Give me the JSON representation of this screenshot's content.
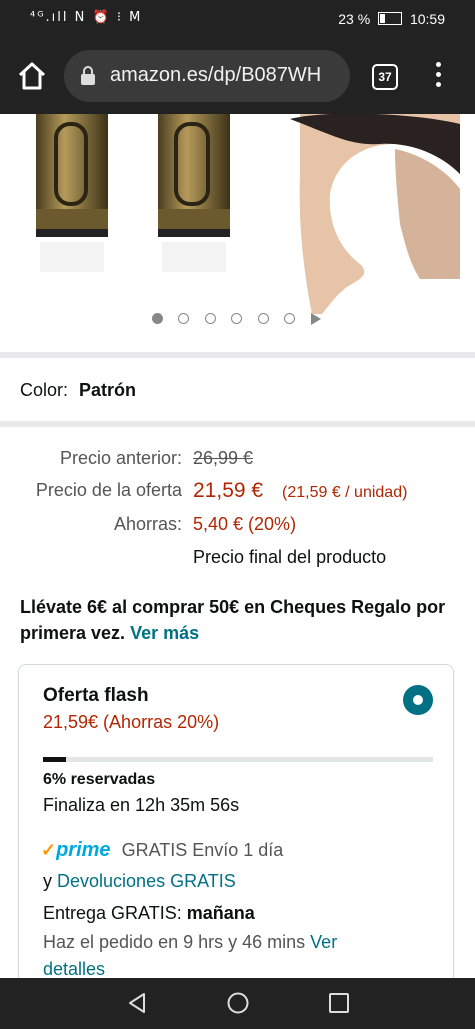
{
  "status_bar": {
    "left": "⁴ᴳ.ıll N ⏰ ⁝ M",
    "battery": "23 %",
    "time": "10:59"
  },
  "browser": {
    "url": "amazon.es/dp/B087WH",
    "tab_count": "37"
  },
  "gallery": {
    "dot_count": 6,
    "active_index": 0
  },
  "product": {
    "color_label": "Color:",
    "color_value": "Patrón"
  },
  "pricing": {
    "previous_label": "Precio anterior:",
    "previous_price": "26,99 €",
    "offer_label": "Precio de la oferta",
    "offer_price": "21,59 €",
    "unit_price": "(21,59 € / unidad)",
    "savings_label": "Ahorras:",
    "savings_value": "5,40 € (20%)",
    "final_note": "Precio final del producto"
  },
  "promo": {
    "text": "Llévate 6€ al comprar 50€ en Cheques Regalo por primera vez.",
    "link": "Ver más"
  },
  "flash_offer": {
    "title": "Oferta flash",
    "price_line": "21,59€ (Ahorras 20%)",
    "reserved_fraction": 0.06,
    "reserved_text": "6% reservadas",
    "ends_text": "Finaliza en 12h 35m 56s",
    "prime_label": "prime",
    "shipping_text": "GRATIS Envío 1 día",
    "returns_prefix": "y",
    "returns_link": "Devoluciones GRATIS",
    "delivery_prefix": "Entrega GRATIS:",
    "delivery_day": "mañana",
    "order_text": "Haz el pedido en 9 hrs y 46 mins",
    "details_link_1": "Ver",
    "details_link_2": "detalles"
  },
  "colors": {
    "link": "#007185",
    "price_red": "#b12704",
    "prime_blue": "#00a8e1"
  }
}
